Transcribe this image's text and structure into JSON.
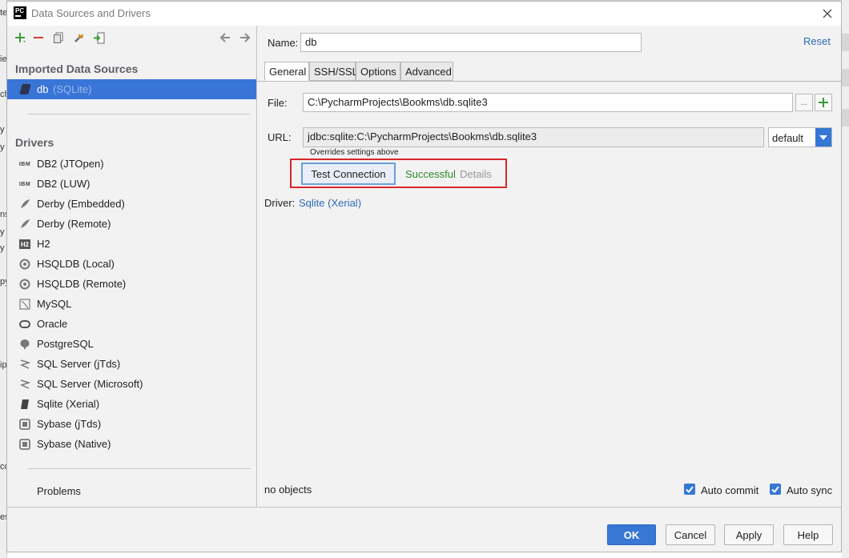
{
  "window": {
    "title": "Data Sources and Drivers"
  },
  "background_hints": [
    "te",
    "ie",
    "ch",
    "y",
    "y",
    "ns",
    "y",
    "y",
    "py",
    "ip",
    "co",
    "es"
  ],
  "sidebar": {
    "imported_header": "Imported Data Sources",
    "data_source": {
      "name": "db",
      "type": "(SQLite)"
    },
    "drivers_header": "Drivers",
    "drivers": [
      {
        "label": "DB2 (JTOpen)",
        "icon": "ibm-icon"
      },
      {
        "label": "DB2 (LUW)",
        "icon": "ibm-icon"
      },
      {
        "label": "Derby (Embedded)",
        "icon": "derby-feather-icon"
      },
      {
        "label": "Derby (Remote)",
        "icon": "derby-feather-icon"
      },
      {
        "label": "H2",
        "icon": "h2-icon"
      },
      {
        "label": "HSQLDB (Local)",
        "icon": "hsqldb-icon"
      },
      {
        "label": "HSQLDB (Remote)",
        "icon": "hsqldb-icon"
      },
      {
        "label": "MySQL",
        "icon": "mysql-icon"
      },
      {
        "label": "Oracle",
        "icon": "oracle-icon"
      },
      {
        "label": "PostgreSQL",
        "icon": "postgresql-icon"
      },
      {
        "label": "SQL Server (jTds)",
        "icon": "sqlserver-icon"
      },
      {
        "label": "SQL Server (Microsoft)",
        "icon": "sqlserver-icon"
      },
      {
        "label": "Sqlite (Xerial)",
        "icon": "sqlite-icon"
      },
      {
        "label": "Sybase (jTds)",
        "icon": "sybase-icon"
      },
      {
        "label": "Sybase (Native)",
        "icon": "sybase-icon"
      }
    ],
    "problems": "Problems"
  },
  "form": {
    "name_label": "Name:",
    "name_value": "db",
    "reset": "Reset",
    "tabs": [
      "General",
      "SSH/SSL",
      "Options",
      "Advanced"
    ],
    "active_tab": "General",
    "file_label": "File:",
    "file_value": "C:\\PycharmProjects\\Bookms\\db.sqlite3",
    "browse_label": "...",
    "url_label": "URL:",
    "url_value": "jdbc:sqlite:C:\\PycharmProjects\\Bookms\\db.sqlite3",
    "url_help": "Overrides settings above",
    "url_mode": "default",
    "test_button": "Test Connection",
    "test_status": "Successful",
    "details": "Details",
    "driver_label": "Driver:",
    "driver_value": "Sqlite (Xerial)",
    "objects_status": "no objects",
    "auto_commit": {
      "label": "Auto commit",
      "checked": true
    },
    "auto_sync": {
      "label": "Auto sync",
      "checked": true
    }
  },
  "footer": {
    "ok": "OK",
    "cancel": "Cancel",
    "apply": "Apply",
    "help": "Help"
  },
  "colors": {
    "selection": "#3875d7",
    "primary_button": "#3878d4",
    "link": "#2e6ab8",
    "success": "#2a8a2a",
    "highlight_border": "#d9262b"
  }
}
